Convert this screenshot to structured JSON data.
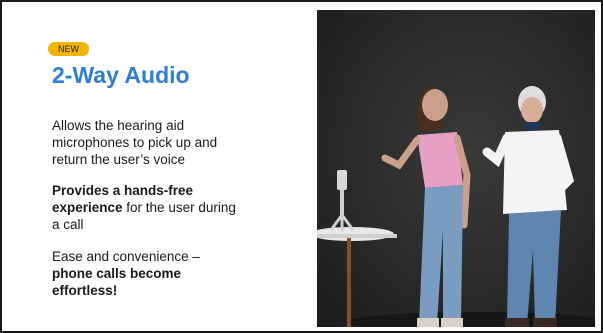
{
  "badge": {
    "label": "NEW"
  },
  "title": "2-Way Audio",
  "paragraphs": {
    "p1": "Allows the hearing aid microphones to pick up and return the user’s voice",
    "p2_bold": "Provides a hands-free experience",
    "p2_rest": " for the user during a call",
    "p3_normal": "Ease and convenience – ",
    "p3_bold": "phone calls become effortless!"
  },
  "colors": {
    "accent_title": "#2f7ed8",
    "badge_bg": "#f5b400",
    "photo_bg": "#2a2a2a"
  },
  "image": {
    "subject": "two-women-with-phone-on-tripod-photo"
  }
}
